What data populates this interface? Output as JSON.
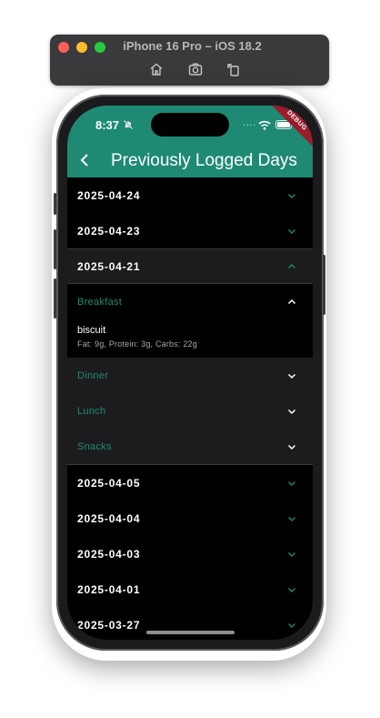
{
  "simulator": {
    "title": "iPhone 16 Pro – iOS 18.2",
    "buttons": [
      "home-icon",
      "screenshot-icon",
      "rotate-icon"
    ]
  },
  "status_bar": {
    "time": "8:37",
    "signal": "....",
    "debug_label": "DEBUG"
  },
  "appbar": {
    "title": "Previously Logged Days",
    "color": "#1f8a73"
  },
  "days": [
    {
      "date": "2025-04-24",
      "expanded": false
    },
    {
      "date": "2025-04-23",
      "expanded": false
    },
    {
      "date": "2025-04-21",
      "expanded": true
    },
    {
      "date": "2025-04-05",
      "expanded": false
    },
    {
      "date": "2025-04-04",
      "expanded": false
    },
    {
      "date": "2025-04-03",
      "expanded": false
    },
    {
      "date": "2025-04-01",
      "expanded": false
    },
    {
      "date": "2025-03-27",
      "expanded": false
    }
  ],
  "expanded_day": {
    "meals": [
      {
        "name": "Breakfast",
        "expanded": true,
        "items": [
          {
            "name": "biscuit",
            "macros": "Fat: 9g, Protein: 3g, Carbs: 22g"
          }
        ]
      },
      {
        "name": "Dinner",
        "expanded": false
      },
      {
        "name": "Lunch",
        "expanded": false
      },
      {
        "name": "Snacks",
        "expanded": false
      }
    ]
  },
  "colors": {
    "accent": "#1f8a73",
    "background": "#000000",
    "panel": "#1c1c1e"
  }
}
